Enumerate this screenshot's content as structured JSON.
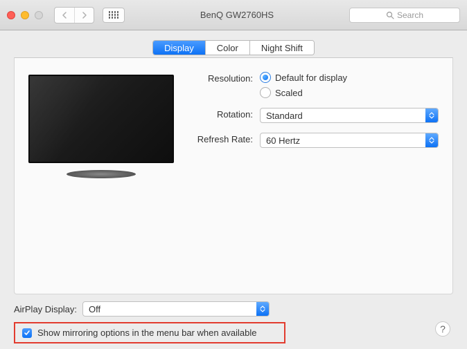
{
  "window": {
    "title": "BenQ GW2760HS",
    "search_placeholder": "Search"
  },
  "tabs": {
    "display": "Display",
    "color": "Color",
    "night_shift": "Night Shift",
    "active": "display"
  },
  "settings": {
    "resolution_label": "Resolution:",
    "resolution_options": {
      "default": "Default for display",
      "scaled": "Scaled"
    },
    "rotation_label": "Rotation:",
    "rotation_value": "Standard",
    "refresh_label": "Refresh Rate:",
    "refresh_value": "60 Hertz"
  },
  "bottom": {
    "airplay_label": "AirPlay Display:",
    "airplay_value": "Off",
    "mirroring_label": "Show mirroring options in the menu bar when available",
    "help": "?"
  }
}
